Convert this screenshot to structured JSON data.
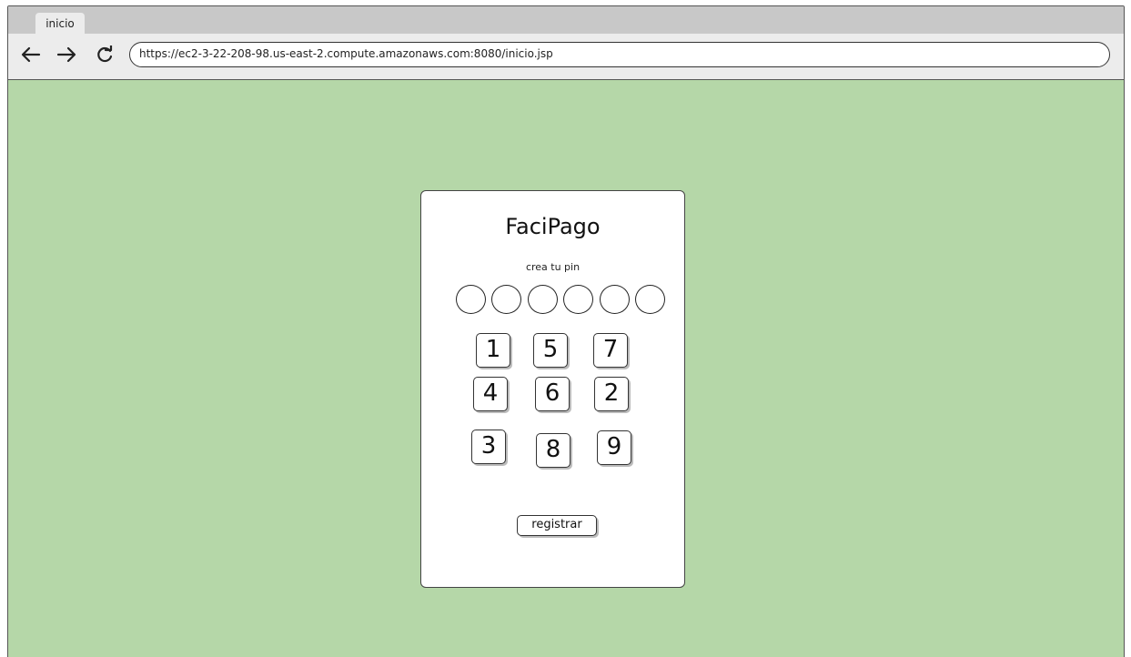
{
  "browser": {
    "tab_label": "inicio",
    "url": "https://ec2-3-22-208-98.us-east-2.compute.amazonaws.com:8080/inicio.jsp",
    "back_icon": "arrow-left",
    "forward_icon": "arrow-right",
    "reload_icon": "reload"
  },
  "page": {
    "background_color": "#b5d7a8",
    "card": {
      "title": "FaciPago",
      "subtitle": "crea tu pin",
      "pin_slots": 6,
      "keys": [
        "1",
        "5",
        "7",
        "4",
        "6",
        "2",
        "3",
        "8",
        "9"
      ],
      "register_label": "registrar"
    }
  }
}
